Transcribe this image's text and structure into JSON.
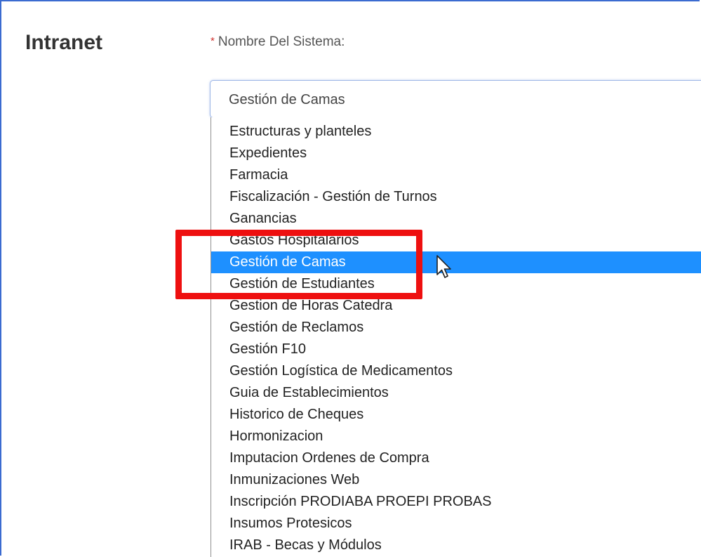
{
  "panel": {
    "title": "Intranet"
  },
  "field": {
    "required_mark": "*",
    "label": "Nombre Del Sistema:",
    "selected_value": "Gestión de Camas"
  },
  "dropdown": {
    "selected_index": 6,
    "options": [
      "Estructuras y planteles",
      "Expedientes",
      "Farmacia",
      "Fiscalización - Gestión de Turnos",
      "Ganancias",
      "Gastos Hospitalarios",
      "Gestión de Camas",
      "Gestión de Estudiantes",
      "Gestion de Horas Catedra",
      "Gestión de Reclamos",
      "Gestión F10",
      "Gestión Logística de Medicamentos",
      "Guia de Establecimientos",
      "Historico de Cheques",
      "Hormonizacion",
      "Imputacion Ordenes de Compra",
      "Inmunizaciones Web",
      "Inscripción PRODIABA PROEPI PROBAS",
      "Insumos Protesicos",
      "IRAB - Becas y Módulos"
    ]
  },
  "colors": {
    "accent": "#3b6bd0",
    "selected_bg": "#1e90ff",
    "highlight": "#ee1010"
  }
}
